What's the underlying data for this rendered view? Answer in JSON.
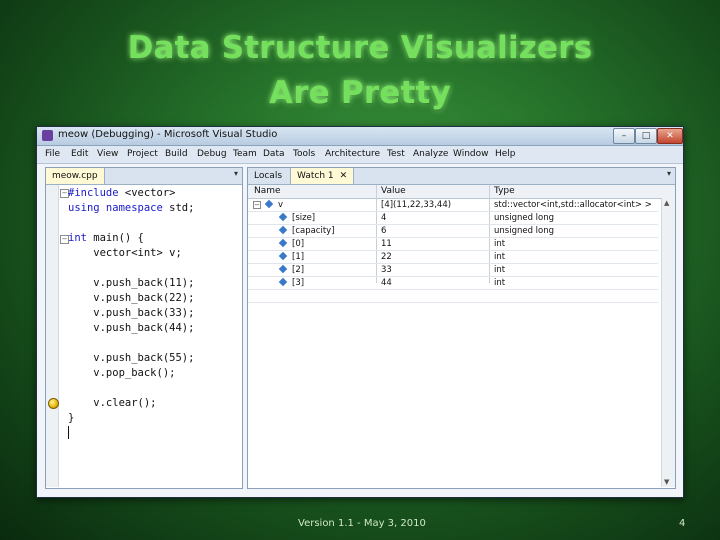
{
  "slide": {
    "title_line1": "Data Structure Visualizers",
    "title_line2": "Are Pretty",
    "footer": "Version 1.1 - May 3, 2010",
    "page_number": "4"
  },
  "window": {
    "title": "meow (Debugging) - Microsoft Visual Studio",
    "controls": {
      "minimize": "–",
      "maximize": "□",
      "close": "✕"
    }
  },
  "menu": [
    "File",
    "Edit",
    "View",
    "Project",
    "Build",
    "Debug",
    "Team",
    "Data",
    "Tools",
    "Architecture",
    "Test",
    "Analyze",
    "Window",
    "Help"
  ],
  "editor": {
    "tab": "meow.cpp",
    "dropdown": "▾",
    "lines": [
      {
        "kw": "#include",
        "rest": " <vector>"
      },
      {
        "kw": "using namespace",
        "rest": " std;"
      },
      {
        "kw": "",
        "rest": ""
      },
      {
        "kw": "int",
        "rest": " main() {"
      },
      {
        "kw": "",
        "rest": "    vector<int> v;"
      },
      {
        "kw": "",
        "rest": ""
      },
      {
        "kw": "",
        "rest": "    v.push_back(11);"
      },
      {
        "kw": "",
        "rest": "    v.push_back(22);"
      },
      {
        "kw": "",
        "rest": "    v.push_back(33);"
      },
      {
        "kw": "",
        "rest": "    v.push_back(44);"
      },
      {
        "kw": "",
        "rest": ""
      },
      {
        "kw": "",
        "rest": "    v.push_back(55);"
      },
      {
        "kw": "",
        "rest": "    v.pop_back();"
      },
      {
        "kw": "",
        "rest": ""
      },
      {
        "kw": "",
        "rest": "    v.clear();"
      },
      {
        "kw": "",
        "rest": "}"
      }
    ],
    "collapse_symbol": "−"
  },
  "watch": {
    "tab_locals": "Locals",
    "tab_watch": "Watch 1",
    "tab_close": "✕",
    "dropdown": "▾",
    "headers": {
      "name": "Name",
      "value": "Value",
      "type": "Type"
    },
    "rows": [
      {
        "name": "v",
        "value": "[4](11,22,33,44)",
        "type": "std::vector<int,std::allocator<int> >",
        "expander": "−"
      },
      {
        "name": "[size]",
        "value": "4",
        "type": "unsigned long"
      },
      {
        "name": "[capacity]",
        "value": "6",
        "type": "unsigned long"
      },
      {
        "name": "[0]",
        "value": "11",
        "type": "int"
      },
      {
        "name": "[1]",
        "value": "22",
        "type": "int"
      },
      {
        "name": "[2]",
        "value": "33",
        "type": "int"
      },
      {
        "name": "[3]",
        "value": "44",
        "type": "int"
      }
    ],
    "scroll_up": "▲",
    "scroll_down": "▼"
  }
}
